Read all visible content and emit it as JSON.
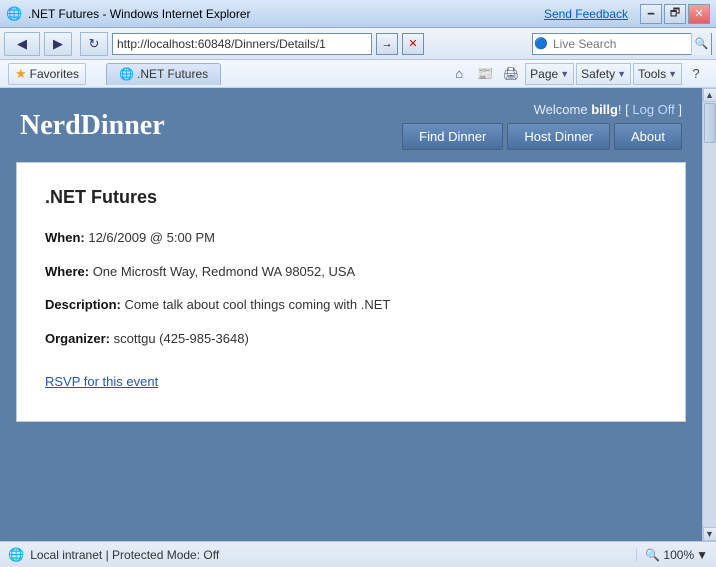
{
  "titlebar": {
    "icon": "🌐",
    "title": ".NET Futures - Windows Internet Explorer",
    "send_feedback": "Send Feedback",
    "min": "🗕",
    "restore": "🗗",
    "close": "✕"
  },
  "addressbar": {
    "back": "◀",
    "forward": "▶",
    "refresh": "↻",
    "stop": "✕",
    "url": "http://localhost:60848/Dinners/Details/1",
    "go_arrow": "→",
    "ie_icon": "🔵",
    "live_search_label": "Live Search",
    "search_icon": "🔍"
  },
  "favbar": {
    "favorites_star": "★",
    "favorites_label": "Favorites",
    "tab_icon": "🌐",
    "tab_label": ".NET Futures",
    "home": "⌂",
    "feeds": "📰",
    "print": "🖨",
    "page": "Page",
    "safety": "Safety",
    "tools": "Tools",
    "help": "?"
  },
  "header": {
    "title": "NerdDinner",
    "welcome_prefix": "Welcome ",
    "username": "billg",
    "welcome_suffix": "! [ ",
    "logoff": "Log Off",
    "welcome_end": " ]",
    "nav": {
      "find": "Find Dinner",
      "host": "Host Dinner",
      "about": "About"
    }
  },
  "dinner": {
    "title": ".NET Futures",
    "when_label": "When:",
    "when_value": "12/6/2009 @ 5:00 PM",
    "where_label": "Where:",
    "where_value": "One Microsft Way, Redmond WA 98052, USA",
    "description_label": "Description:",
    "description_value": "Come talk about cool things coming with .NET",
    "organizer_label": "Organizer:",
    "organizer_value": "scottgu (425-985-3648)",
    "rsvp": "RSVP for this event"
  },
  "statusbar": {
    "icon": "🌐",
    "text": "Local intranet | Protected Mode: Off",
    "zoom": "🔍 100%",
    "arrow": "▼"
  }
}
